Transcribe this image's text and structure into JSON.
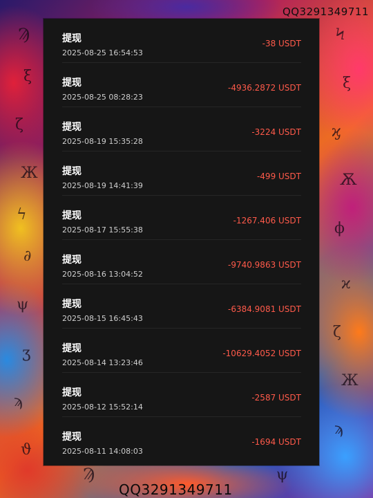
{
  "watermark": {
    "top": "QQ3291349711",
    "bottom": "QQ3291349711"
  },
  "colors": {
    "panel_bg": "#161616",
    "amount_negative": "#ff5a4a",
    "title_text": "#ffffff",
    "time_text": "#cfcfcf"
  },
  "records": [
    {
      "title": "提现",
      "time": "2025-08-25 16:54:53",
      "amount": "-38 USDT"
    },
    {
      "title": "提现",
      "time": "2025-08-25 08:28:23",
      "amount": "-4936.2872 USDT"
    },
    {
      "title": "提现",
      "time": "2025-08-19 15:35:28",
      "amount": "-3224 USDT"
    },
    {
      "title": "提现",
      "time": "2025-08-19 14:41:39",
      "amount": "-499 USDT"
    },
    {
      "title": "提现",
      "time": "2025-08-17 15:55:38",
      "amount": "-1267.406 USDT"
    },
    {
      "title": "提现",
      "time": "2025-08-16 13:04:52",
      "amount": "-9740.9863 USDT"
    },
    {
      "title": "提现",
      "time": "2025-08-15 16:45:43",
      "amount": "-6384.9081 USDT"
    },
    {
      "title": "提现",
      "time": "2025-08-14 13:23:46",
      "amount": "-10629.4052 USDT"
    },
    {
      "title": "提现",
      "time": "2025-08-12 15:52:14",
      "amount": "-2587 USDT"
    },
    {
      "title": "提现",
      "time": "2025-08-11 14:08:03",
      "amount": "-1694 USDT"
    }
  ]
}
